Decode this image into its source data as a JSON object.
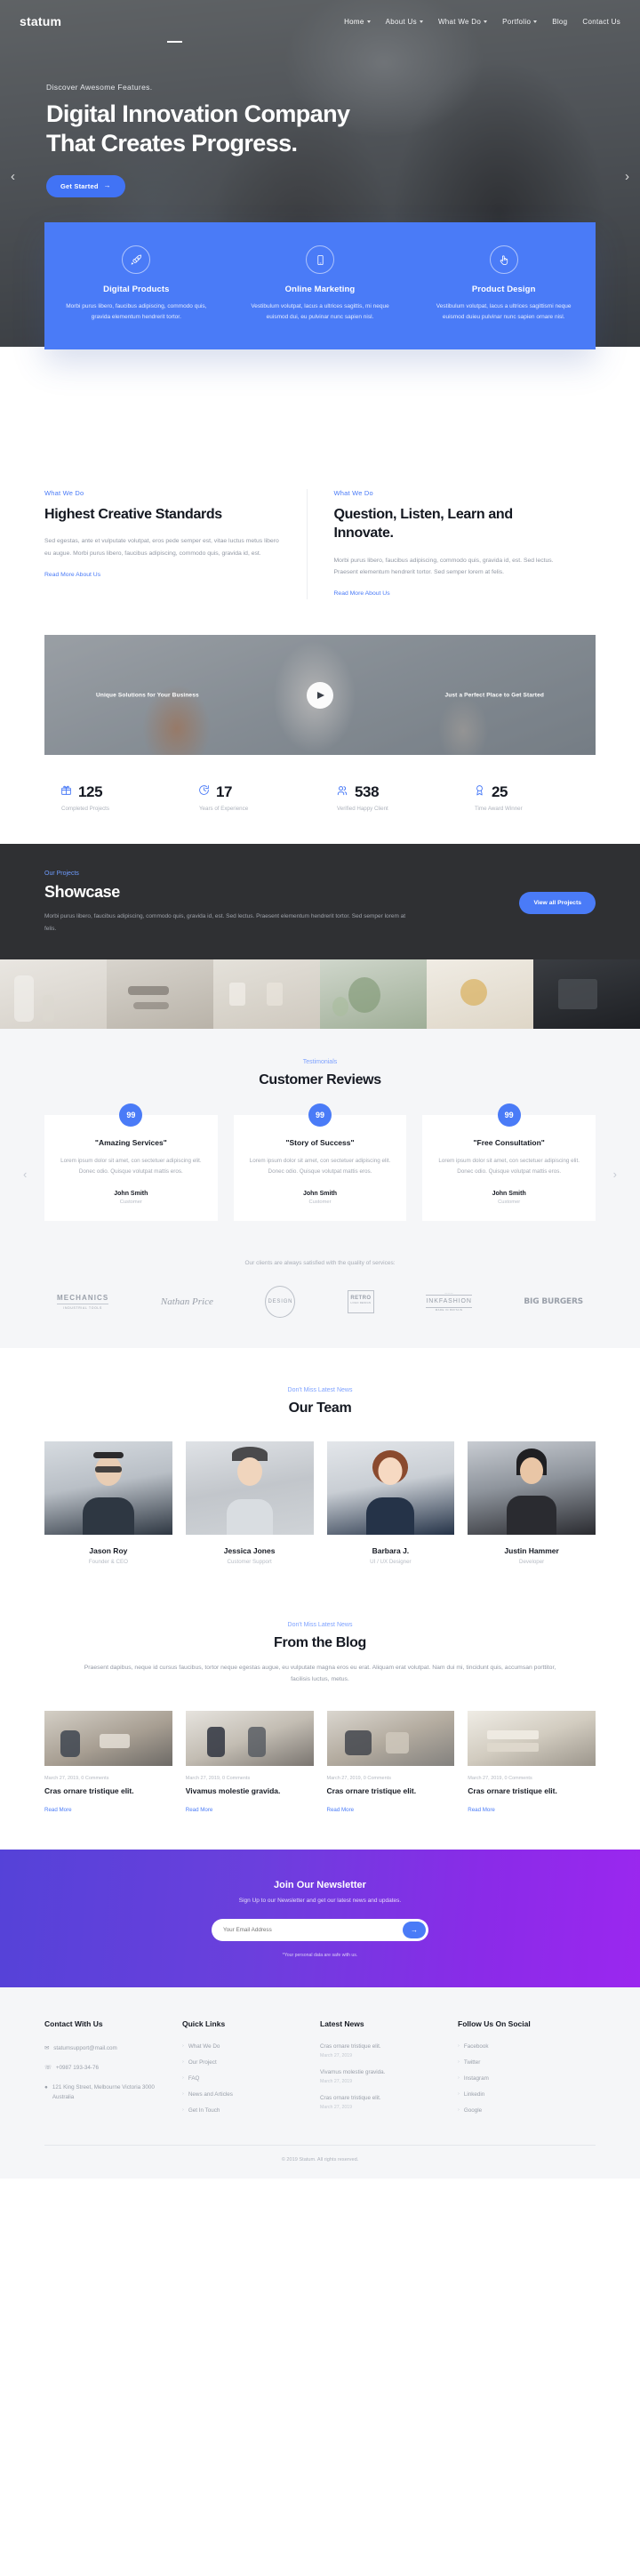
{
  "brand": {
    "logo": "statum",
    "accent": "#4a7bf7"
  },
  "nav": {
    "items": [
      {
        "label": "Home",
        "has_dropdown": true,
        "active": true
      },
      {
        "label": "About Us",
        "has_dropdown": true,
        "active": false
      },
      {
        "label": "What We Do",
        "has_dropdown": true,
        "active": false
      },
      {
        "label": "Portfolio",
        "has_dropdown": true,
        "active": false
      },
      {
        "label": "Blog",
        "has_dropdown": false,
        "active": false
      },
      {
        "label": "Contact Us",
        "has_dropdown": false,
        "active": false
      }
    ]
  },
  "hero": {
    "eyebrow": "Discover Awesome Features.",
    "title_line1": "Digital Innovation Company",
    "title_line2": "That Creates Progress.",
    "cta": "Get Started",
    "prev_icon": "chevron-left-icon",
    "next_icon": "chevron-right-icon"
  },
  "features": [
    {
      "icon": "rocket-icon",
      "title": "Digital Products",
      "desc": "Morbi purus libero, faucibus adipiscing, commodo quis, gravida elementum hendrerit tortor."
    },
    {
      "icon": "mobile-icon",
      "title": "Online Marketing",
      "desc": "Vestibulum volutpat, lacus a ultrices sagittis, mi neque euismod dui, eu pulvinar nunc sapien nisl."
    },
    {
      "icon": "cursor-tap-icon",
      "title": "Product Design",
      "desc": "Vestibulum volutpat, lacus a ultrices sagittismi neque euismod duieu pulvinar nunc sapien ornare nisl."
    }
  ],
  "what_we_do": {
    "left": {
      "eyebrow": "What We Do",
      "title": "Highest Creative Standards",
      "body": "Sed egestas, ante et vulputate volutpat, eros pede semper est, vitae luctus metus libero eu augue. Morbi purus libero, faucibus adipiscing, commodo quis, gravida id, est.",
      "link": "Read More About Us"
    },
    "right": {
      "eyebrow": "What We Do",
      "title": "Question, Listen, Learn and Innovate.",
      "body": "Morbi purus libero, faucibus adipiscing, commodo quis, gravida id, est. Sed lectus. Praesent elementum hendrerit tortor. Sed semper lorem at felis.",
      "link": "Read More About Us"
    }
  },
  "video": {
    "caption_left": "Unique Solutions for Your Business",
    "caption_right": "Just a Perfect Place to Get Started",
    "play_icon": "play-icon"
  },
  "stats": [
    {
      "icon": "gift-icon",
      "value": "125",
      "label": "Completed Projects"
    },
    {
      "icon": "clock-icon",
      "value": "17",
      "label": "Years of Experience"
    },
    {
      "icon": "users-icon",
      "value": "538",
      "label": "Verified Happy Client"
    },
    {
      "icon": "award-icon",
      "value": "25",
      "label": "Time Award Winner"
    }
  ],
  "showcase": {
    "eyebrow": "Our Projects",
    "title": "Showcase",
    "desc": "Morbi purus libero, faucibus adipiscing, commodo quis, gravida id, est. Sed lectus. Praesent elementum hendrerit tortor. Sed semper lorem at felis.",
    "button": "View all Projects"
  },
  "testimonials": {
    "eyebrow": "Testimonials",
    "title": "Customer Reviews",
    "quote_glyph": "99",
    "prev_icon": "chevron-left-icon",
    "next_icon": "chevron-right-icon",
    "cards": [
      {
        "title": "\"Amazing Services\"",
        "body": "Lorem ipsum dolor sit amet, con sectetuer adipiscing elit. Donec odio. Quisque volutpat mattis eros.",
        "name": "John Smith",
        "role": "Customer"
      },
      {
        "title": "\"Story of Success\"",
        "body": "Lorem ipsum dolor sit amet, con sectetuer adipiscing elit. Donec odio. Quisque volutpat mattis eros.",
        "name": "John Smith",
        "role": "Customer"
      },
      {
        "title": "\"Free Consultation\"",
        "body": "Lorem ipsum dolor sit amet, con sectetuer adipiscing elit. Donec odio. Quisque volutpat mattis eros.",
        "name": "John Smith",
        "role": "Customer"
      }
    ]
  },
  "clients": {
    "note": "Our clients are always satisfied with the quality of services:",
    "logos": [
      {
        "name": "MECHANICS",
        "sub": "INDUSTRIAL TOOLS"
      },
      {
        "name": "Nathan Price",
        "sub": ""
      },
      {
        "name": "DESIGN",
        "sub": ""
      },
      {
        "name": "RETRO",
        "sub": "LOGO DESIGN"
      },
      {
        "name": "INKFASHION",
        "sub": "MADE IN BRITAIN"
      },
      {
        "name": "BIG BURGERS",
        "sub": ""
      }
    ]
  },
  "team": {
    "eyebrow": "Don't Miss Latest News",
    "title": "Our Team",
    "members": [
      {
        "name": "Jason Roy",
        "role": "Founder & CEO"
      },
      {
        "name": "Jessica Jones",
        "role": "Customer Support"
      },
      {
        "name": "Barbara J.",
        "role": "UI / UX Designer"
      },
      {
        "name": "Justin Hammer",
        "role": "Developer"
      }
    ]
  },
  "blog": {
    "eyebrow": "Don't Miss Latest News",
    "title": "From the Blog",
    "intro": "Praesent dapibus, neque id cursus faucibus, tortor neque egestas augue, eu vulputate magna eros eu erat. Aliquam erat volutpat. Nam dui mi, tincidunt quis, accumsan porttitor, facilisis luctus, metus.",
    "posts": [
      {
        "meta": "March 27, 2019, 0 Comments",
        "title": "Cras ornare tristique elit.",
        "link": "Read More"
      },
      {
        "meta": "March 27, 2019, 0 Comments",
        "title": "Vivamus molestie gravida.",
        "link": "Read More"
      },
      {
        "meta": "March 27, 2019, 0 Comments",
        "title": "Cras ornare tristique elit.",
        "link": "Read More"
      },
      {
        "meta": "March 27, 2019, 0 Comments",
        "title": "Cras ornare tristique elit.",
        "link": "Read More"
      }
    ]
  },
  "newsletter": {
    "title": "Join Our Newsletter",
    "subtitle": "Sign Up to our Newsletter and get our latest news and updates.",
    "placeholder": "Your Email Address",
    "send_icon": "send-arrow-icon",
    "note": "*Your personal data are safe with us."
  },
  "footer": {
    "contact": {
      "heading": "Contact With Us",
      "email": "statumsupport@mail.com",
      "phone": "+0987 193-34-76",
      "address": "121 King Street, Melbourne Victoria 3000 Australia",
      "email_icon": "envelope-icon",
      "phone_icon": "phone-icon",
      "pin_icon": "map-pin-icon"
    },
    "quick_links": {
      "heading": "Quick Links",
      "items": [
        "What We Do",
        "Our Project",
        "FAQ",
        "News and Articles",
        "Get In Touch"
      ]
    },
    "latest_news": {
      "heading": "Latest News",
      "items": [
        {
          "title": "Cras ornare tristique elit.",
          "date": "March 27, 2019"
        },
        {
          "title": "Vivamus molestie gravida.",
          "date": "March 27, 2019"
        },
        {
          "title": "Cras ornare tristique elit.",
          "date": "March 27, 2019"
        }
      ]
    },
    "social": {
      "heading": "Follow Us On Social",
      "items": [
        "Facebook",
        "Twitter",
        "Instagram",
        "Linkedin",
        "Google"
      ]
    },
    "copyright": "© 2019 Statum. All rights reserved."
  }
}
